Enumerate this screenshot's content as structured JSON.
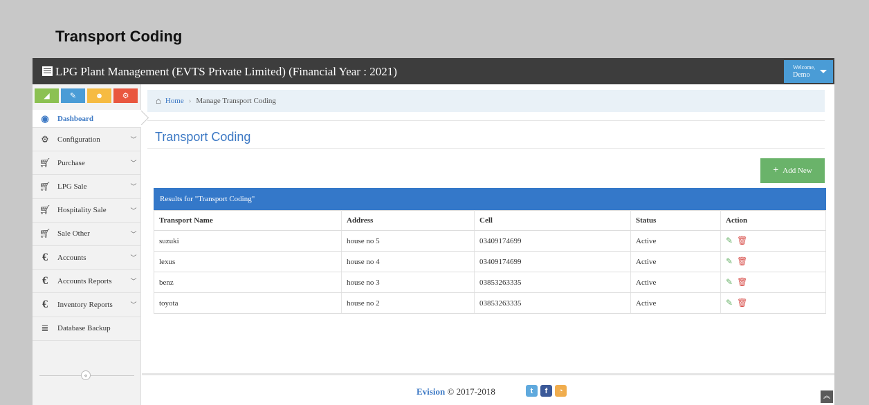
{
  "page_title": "Transport Coding",
  "topbar": {
    "app_title": "LPG Plant Management (EVTS Private Limited) (Financial Year : 2021)",
    "welcome_line1": "Welcome,",
    "welcome_line2": "Demo"
  },
  "sidebar": {
    "shortcuts": [
      {
        "icon": "signal-icon",
        "color": "#8cc152"
      },
      {
        "icon": "pencil-icon",
        "color": "#4a9cd6"
      },
      {
        "icon": "users-icon",
        "color": "#f6bb42"
      },
      {
        "icon": "cogs-icon",
        "color": "#e9573f"
      }
    ],
    "items": [
      {
        "label": "Dashboard",
        "icon": "tachometer-icon",
        "active": true
      },
      {
        "label": "Configuration",
        "icon": "cogs-icon"
      },
      {
        "label": "Purchase",
        "icon": "cart-icon"
      },
      {
        "label": "LPG Sale",
        "icon": "cart-icon"
      },
      {
        "label": "Hospitality Sale",
        "icon": "cart-icon"
      },
      {
        "label": "Sale Other",
        "icon": "cart-icon"
      },
      {
        "label": "Accounts",
        "icon": "euro-icon"
      },
      {
        "label": "Accounts Reports",
        "icon": "euro-icon"
      },
      {
        "label": "Inventory Reports",
        "icon": "euro-icon"
      },
      {
        "label": "Database Backup",
        "icon": "database-icon"
      }
    ]
  },
  "breadcrumb": {
    "home": "Home",
    "current": "Manage Transport Coding"
  },
  "section_title": "Transport Coding",
  "add_button": "Add New",
  "results_title": "Results for \"Transport Coding\"",
  "table": {
    "headers": [
      "Transport Name",
      "Address",
      "Cell",
      "Status",
      "Action"
    ],
    "rows": [
      [
        "suzuki",
        "house no 5",
        "03409174699",
        "Active"
      ],
      [
        "lexus",
        "house no 4",
        "03409174699",
        "Active"
      ],
      [
        "benz",
        "house no 3",
        "03853263335",
        "Active"
      ],
      [
        "toyota",
        "house no 2",
        "03853263335",
        "Active"
      ]
    ]
  },
  "footer": {
    "brand": "Evision",
    "copyright": "© 2017-2018"
  }
}
